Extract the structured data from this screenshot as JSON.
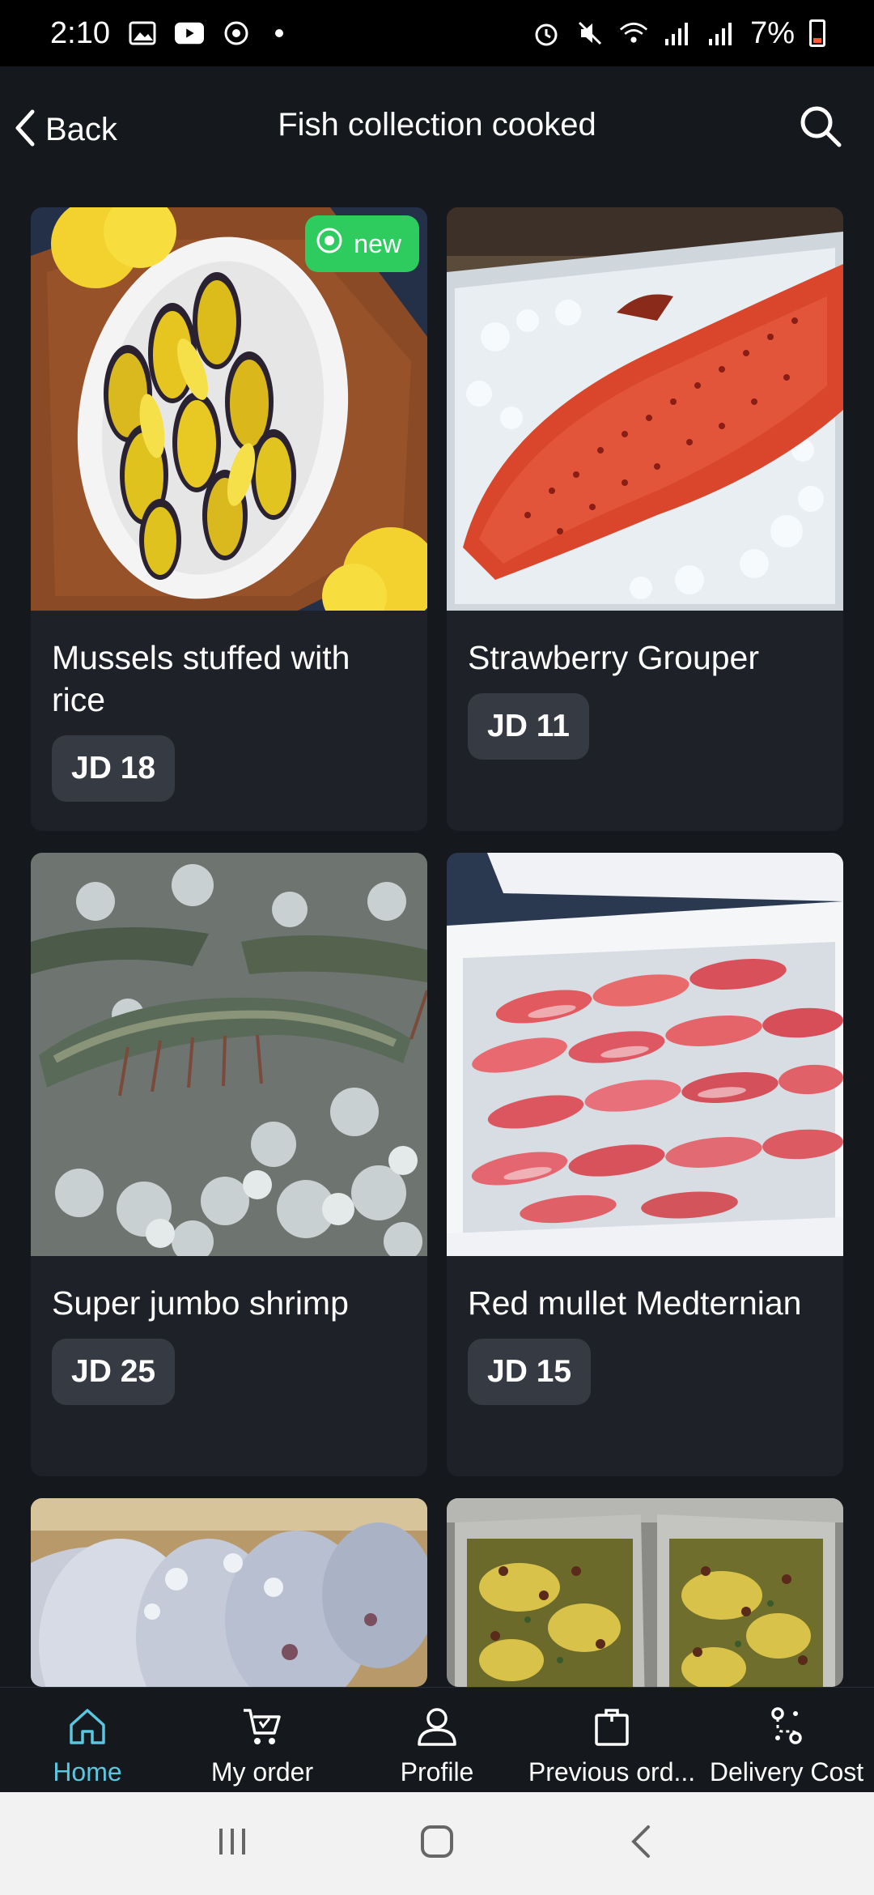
{
  "status_bar": {
    "time": "2:10",
    "battery": "7%",
    "icons": [
      "gallery-icon",
      "youtube-icon",
      "sync-icon",
      "alarm-icon",
      "mute-icon",
      "wifi-icon",
      "signal-icon",
      "signal-icon",
      "battery-icon"
    ]
  },
  "header": {
    "back_label": "Back",
    "title": "Fish collection cooked",
    "search_icon": "search-icon"
  },
  "products": [
    {
      "name": "Mussels stuffed with rice",
      "price": "JD 18",
      "badge": "new",
      "image": "mussels-rice-photo"
    },
    {
      "name": "Strawberry Grouper",
      "price": "JD 11",
      "image": "grouper-photo"
    },
    {
      "name": "Super jumbo shrimp",
      "price": "JD 25",
      "image": "shrimp-photo"
    },
    {
      "name": "Red mullet Medternian",
      "price": "JD 15",
      "image": "red-mullet-photo"
    },
    {
      "name": "",
      "price": "",
      "image": "silver-pomfret-photo"
    },
    {
      "name": "",
      "price": "",
      "image": "octopus-trays-photo"
    }
  ],
  "bottom_nav": {
    "items": [
      {
        "label": "Home",
        "icon": "home-icon",
        "active": true
      },
      {
        "label": "My order",
        "icon": "cart-icon"
      },
      {
        "label": "Profile",
        "icon": "profile-icon"
      },
      {
        "label": "Previous ord...",
        "icon": "bag-icon"
      },
      {
        "label": "Delivery Cost",
        "icon": "route-icon"
      }
    ]
  },
  "colors": {
    "background": "#15181d",
    "card": "#1e2128",
    "price_badge": "#363a42",
    "new_badge": "#2ecc5e",
    "active_nav": "#5ac6e0"
  }
}
